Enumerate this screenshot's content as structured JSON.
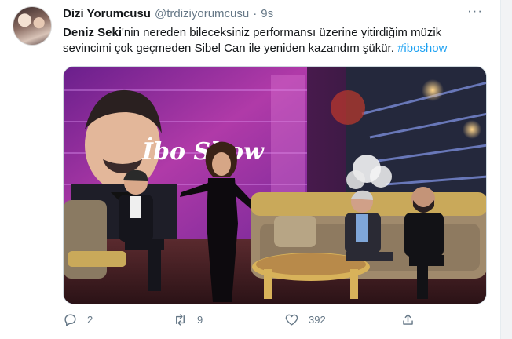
{
  "tweet": {
    "author_name": "Dizi Yorumcusu",
    "author_handle": "@trdiziyorumcusu",
    "separator": "·",
    "time": "9s",
    "more_label": "···",
    "text_bold": "Deniz Seki",
    "text_main": "'nin nereden bileceksiniz performansı üzerine yitirdiğim müzik sevincimi çok geçmeden Sibel Can ile yeniden kazandım şükür. ",
    "hashtag": "#iboshow",
    "media": {
      "screen_text": "İbo Show"
    },
    "actions": {
      "reply_count": "2",
      "retweet_count": "9",
      "like_count": "392"
    }
  },
  "colors": {
    "accent": "#1da1f2",
    "text": "#14171a",
    "muted": "#657786"
  }
}
